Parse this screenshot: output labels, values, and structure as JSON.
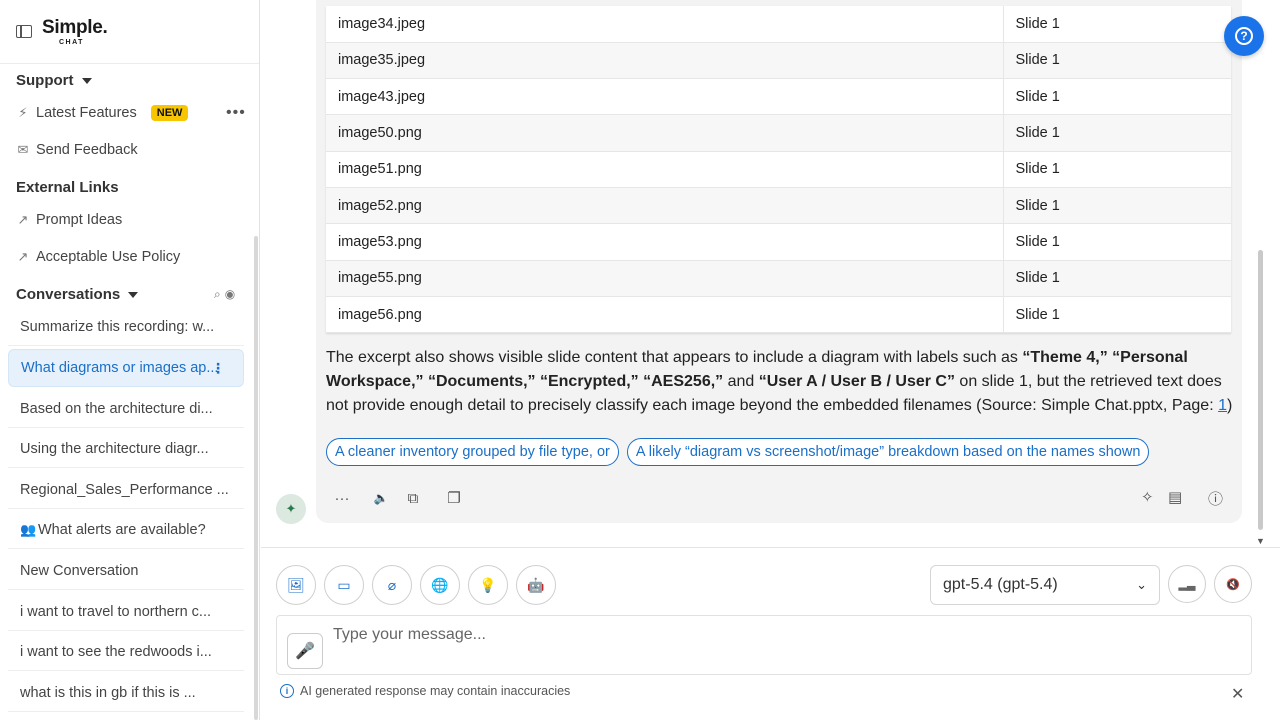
{
  "app": {
    "logo_main": "Simple.",
    "logo_sub": "CHAT"
  },
  "sidebar": {
    "support_title": "Support",
    "latest_features": "Latest Features",
    "new_badge": "NEW",
    "send_feedback": "Send Feedback",
    "external_title": "External Links",
    "prompt_ideas": "Prompt Ideas",
    "acceptable_use": "Acceptable Use Policy",
    "conversations_title": "Conversations",
    "conversations": [
      "Summarize this recording: w...",
      "What diagrams or images ap...",
      "Based on the architecture di...",
      "Using the architecture diagr...",
      "Regional_Sales_Performance ...",
      "What alerts are available?",
      "New Conversation",
      "i want to travel to northern c...",
      "i want to see the redwoods i...",
      "what is this in gb if this is ..."
    ]
  },
  "table": {
    "rows": [
      [
        "image34.jpeg",
        "Slide 1"
      ],
      [
        "image35.jpeg",
        "Slide 1"
      ],
      [
        "image43.jpeg",
        "Slide 1"
      ],
      [
        "image50.png",
        "Slide 1"
      ],
      [
        "image51.png",
        "Slide 1"
      ],
      [
        "image52.png",
        "Slide 1"
      ],
      [
        "image53.png",
        "Slide 1"
      ],
      [
        "image55.png",
        "Slide 1"
      ],
      [
        "image56.png",
        "Slide 1"
      ]
    ]
  },
  "message": {
    "p1": "The excerpt also shows visible slide content that appears to include a diagram with labels such as ",
    "b1": "“Theme 4,” “Personal Workspace,” “Documents,” “Encrypted,” “AES256,”",
    "p2": " and ",
    "b2": "“User A / User B / User C”",
    "p3": " on slide 1, but the retrieved text does not provide enough detail to precisely classify each image beyond the embedded filenames (Source: Simple Chat.pptx, Page: ",
    "link": "1",
    "p4": ")"
  },
  "chips": [
    "A cleaner inventory grouped by file type, or",
    "A likely “diagram vs screenshot/image” breakdown based on the names shown"
  ],
  "composer": {
    "model": "gpt-5.4 (gpt-5.4)",
    "placeholder": "Type your message...",
    "disclaimer": "AI generated response may contain inaccuracies"
  }
}
